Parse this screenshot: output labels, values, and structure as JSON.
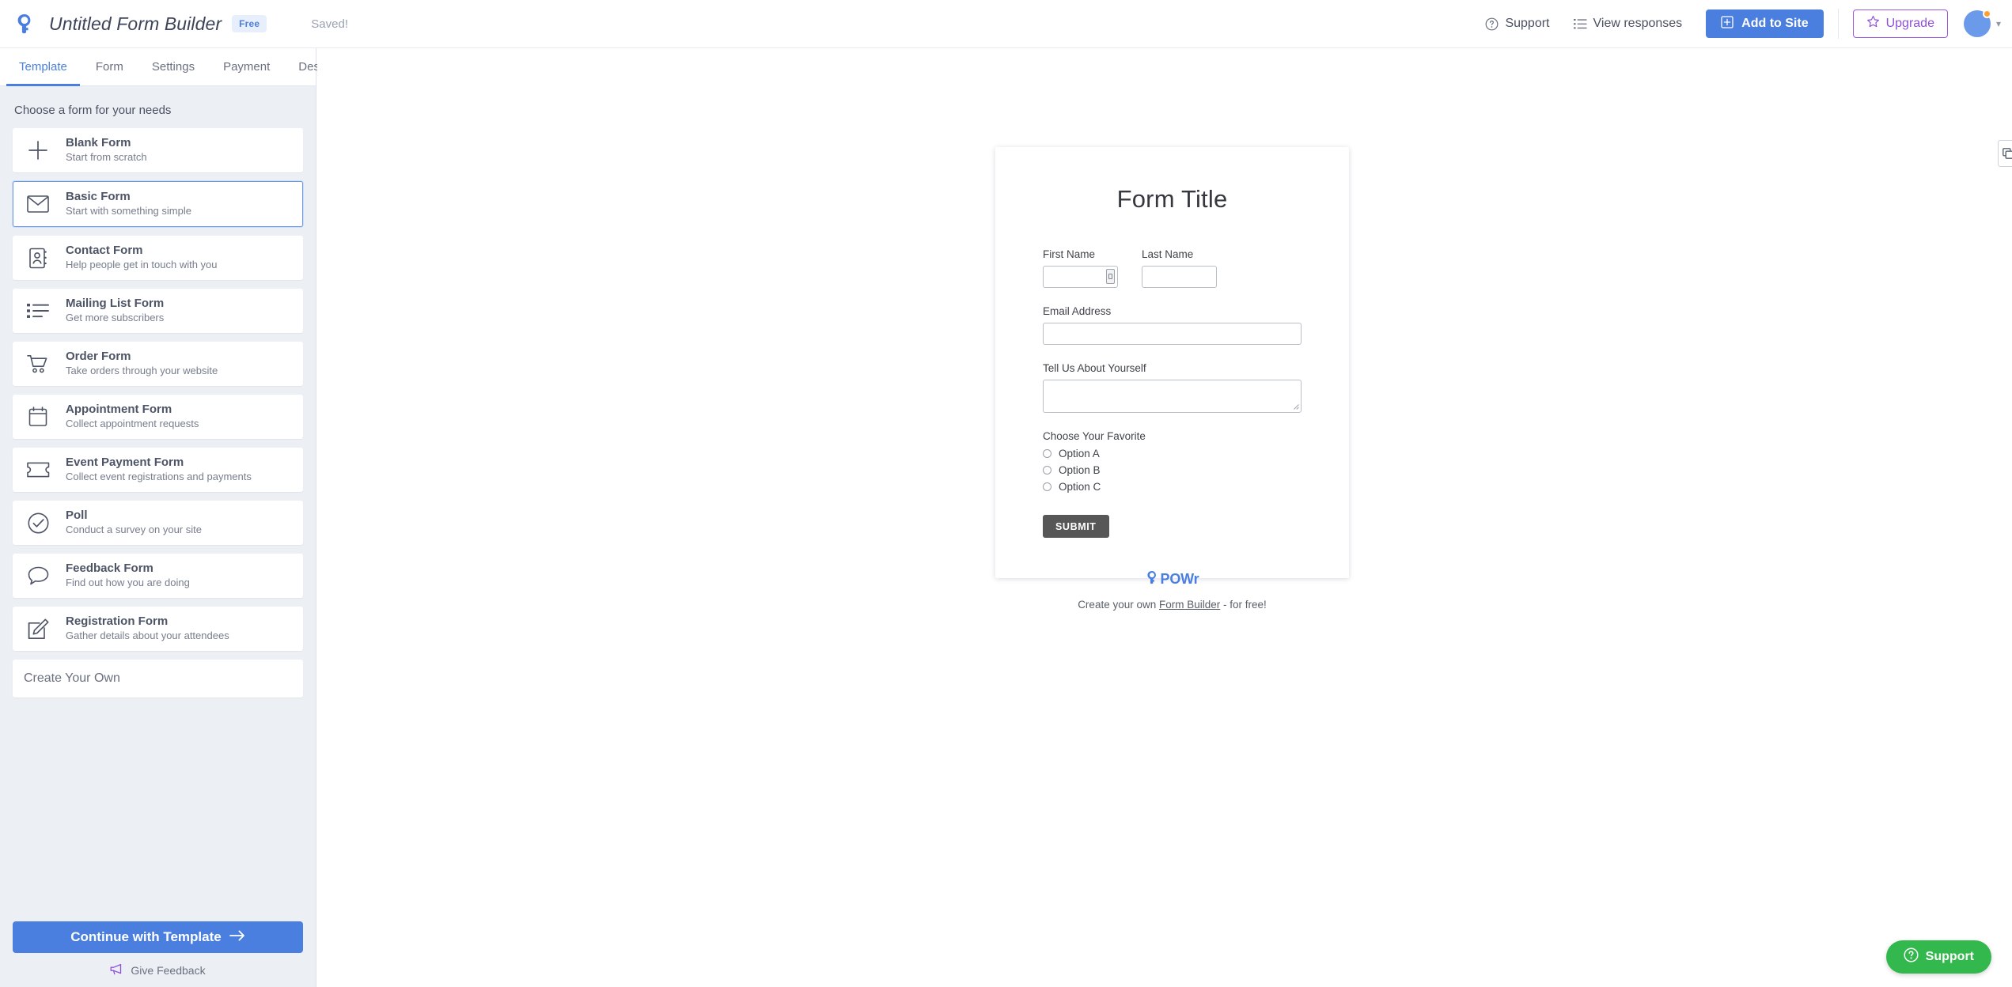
{
  "header": {
    "logo_icon": "powr-logo-icon",
    "title": "Untitled Form Builder",
    "plan_badge": "Free",
    "save_status": "Saved!",
    "support_label": "Support",
    "support_icon": "question-circle-icon",
    "view_responses_label": "View responses",
    "view_responses_icon": "list-icon",
    "add_to_site_label": "Add to Site",
    "add_to_site_icon": "plus-square-icon",
    "upgrade_label": "Upgrade",
    "upgrade_icon": "star-icon",
    "avatar_icon": "avatar",
    "caret_icon": "chevron-down-icon"
  },
  "tabs": [
    {
      "label": "Template",
      "active": true
    },
    {
      "label": "Form",
      "active": false
    },
    {
      "label": "Settings",
      "active": false
    },
    {
      "label": "Payment",
      "active": false
    },
    {
      "label": "Design",
      "active": false
    }
  ],
  "sidebar": {
    "heading": "Choose a form for your needs",
    "templates": [
      {
        "title": "Blank Form",
        "subtitle": "Start from scratch",
        "icon": "plus-icon",
        "selected": false
      },
      {
        "title": "Basic Form",
        "subtitle": "Start with something simple",
        "icon": "envelope-icon",
        "selected": true
      },
      {
        "title": "Contact Form",
        "subtitle": "Help people get in touch with you",
        "icon": "contact-book-icon",
        "selected": false
      },
      {
        "title": "Mailing List Form",
        "subtitle": "Get more subscribers",
        "icon": "list-bullets-icon",
        "selected": false
      },
      {
        "title": "Order Form",
        "subtitle": "Take orders through your website",
        "icon": "shopping-cart-icon",
        "selected": false
      },
      {
        "title": "Appointment Form",
        "subtitle": "Collect appointment requests",
        "icon": "calendar-icon",
        "selected": false
      },
      {
        "title": "Event Payment Form",
        "subtitle": "Collect event registrations and payments",
        "icon": "ticket-icon",
        "selected": false
      },
      {
        "title": "Poll",
        "subtitle": "Conduct a survey on your site",
        "icon": "check-circle-icon",
        "selected": false
      },
      {
        "title": "Feedback Form",
        "subtitle": "Find out how you are doing",
        "icon": "speech-bubble-icon",
        "selected": false
      },
      {
        "title": "Registration Form",
        "subtitle": "Gather details about your attendees",
        "icon": "pencil-square-icon",
        "selected": false
      }
    ],
    "create_your_own": "Create Your Own",
    "continue_label": "Continue with Template",
    "continue_arrow": "arrow-right-icon",
    "feedback_label": "Give Feedback",
    "feedback_icon": "megaphone-icon"
  },
  "preview": {
    "form_title": "Form Title",
    "fields": {
      "first_name_label": "First Name",
      "first_name_value": "",
      "last_name_label": "Last Name",
      "last_name_value": "",
      "email_label": "Email Address",
      "email_value": "",
      "about_label": "Tell Us About Yourself",
      "about_value": "",
      "favorite_label": "Choose Your Favorite"
    },
    "radio_options": [
      "Option A",
      "Option B",
      "Option C"
    ],
    "submit_label": "SUBMIT",
    "branding": {
      "logo_icon": "powr-logo-icon",
      "wordmark": "POWr",
      "tagline_prefix": "Create your own ",
      "tagline_link": "Form Builder",
      "tagline_suffix": " - for free!"
    },
    "edge_button_icon": "duplicate-icon"
  },
  "support_widget": {
    "label": "Support",
    "icon": "question-circle-icon",
    "color": "#32b84c"
  },
  "colors": {
    "accent_blue": "#4a7fe0",
    "upgrade_purple": "#8e4fd8",
    "support_green": "#32b84c",
    "sidebar_bg": "#eceff4",
    "submit_gray": "#575757"
  }
}
